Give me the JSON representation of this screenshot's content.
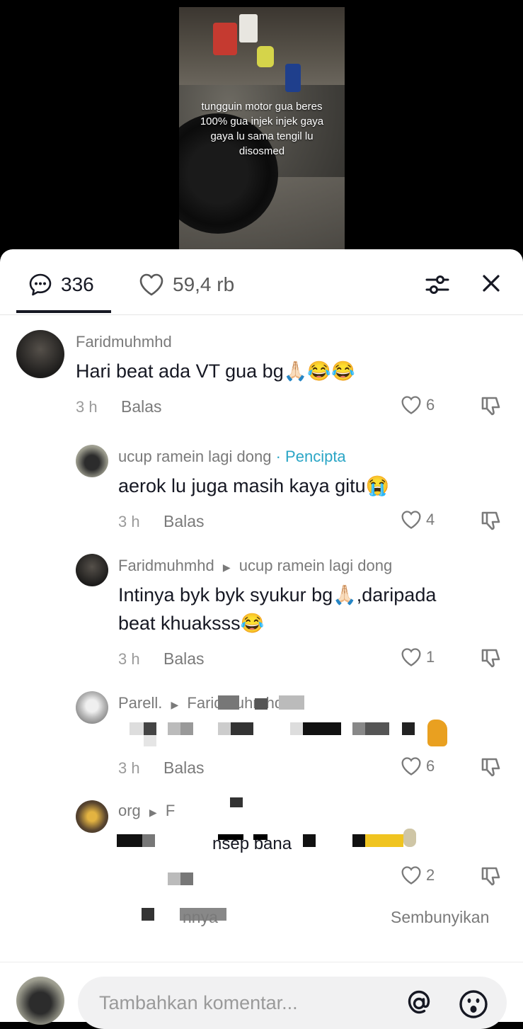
{
  "video": {
    "caption_lines": [
      "tungguin motor gua beres",
      "100% gua injek injek gaya",
      "gaya lu sama tengil lu",
      "disosmed"
    ]
  },
  "tabs": {
    "comments_count": "336",
    "likes_count": "59,4 rb"
  },
  "comments": [
    {
      "username": "Faridmuhmhd",
      "text": "Hari beat ada VT gua bg🙏🏻😂😂",
      "time": "3 h",
      "reply_label": "Balas",
      "likes": "6"
    },
    {
      "username": "ucup ramein lagi dong",
      "badge": "· Pencipta",
      "text": "aerok lu juga masih kaya gitu😭",
      "time": "3 h",
      "reply_label": "Balas",
      "likes": "4"
    },
    {
      "username": "Faridmuhmhd",
      "reply_to": "ucup ramein lagi dong",
      "text_line1": "Intinya byk byk syukur bg🙏🏻,daripada",
      "text_line2": "beat khuaksss😂",
      "time": "3 h",
      "reply_label": "Balas",
      "likes": "1"
    },
    {
      "username": "Parell.",
      "reply_to": "Faridmuhmhd",
      "time": "3 h",
      "reply_label": "Balas",
      "likes": "6"
    },
    {
      "username": "org",
      "reply_to": "F",
      "text_fragment": "nsep bana",
      "likes": "2"
    }
  ],
  "footer_row": {
    "more_fragment": "nnya",
    "hide_label": "Sembunyikan"
  },
  "input": {
    "placeholder": "Tambahkan komentar..."
  },
  "icons": [
    "comment-icon",
    "heart-icon",
    "filter-icon",
    "close-icon",
    "dislike-icon",
    "at-icon",
    "emoji-icon"
  ],
  "colors": {
    "accent_creator": "#2ba6c6",
    "text_primary": "#161823",
    "text_secondary": "#7a7a7a"
  }
}
